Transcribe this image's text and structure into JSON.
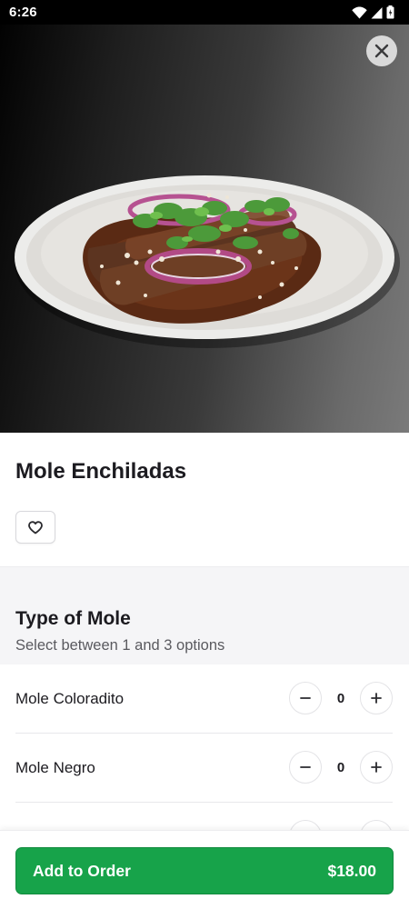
{
  "status_bar": {
    "time": "6:26"
  },
  "item": {
    "title": "Mole Enchiladas"
  },
  "option_group": {
    "title": "Type of Mole",
    "subtitle": "Select between 1 and 3 options",
    "options": [
      {
        "name": "Mole Coloradito",
        "count": "0"
      },
      {
        "name": "Mole Negro",
        "count": "0"
      }
    ]
  },
  "footer": {
    "add_label": "Add to Order",
    "price": "$18.00"
  },
  "colors": {
    "accent": "#17a34a",
    "hero_dark": "#020202",
    "hero_light": "#7a7a7a"
  }
}
